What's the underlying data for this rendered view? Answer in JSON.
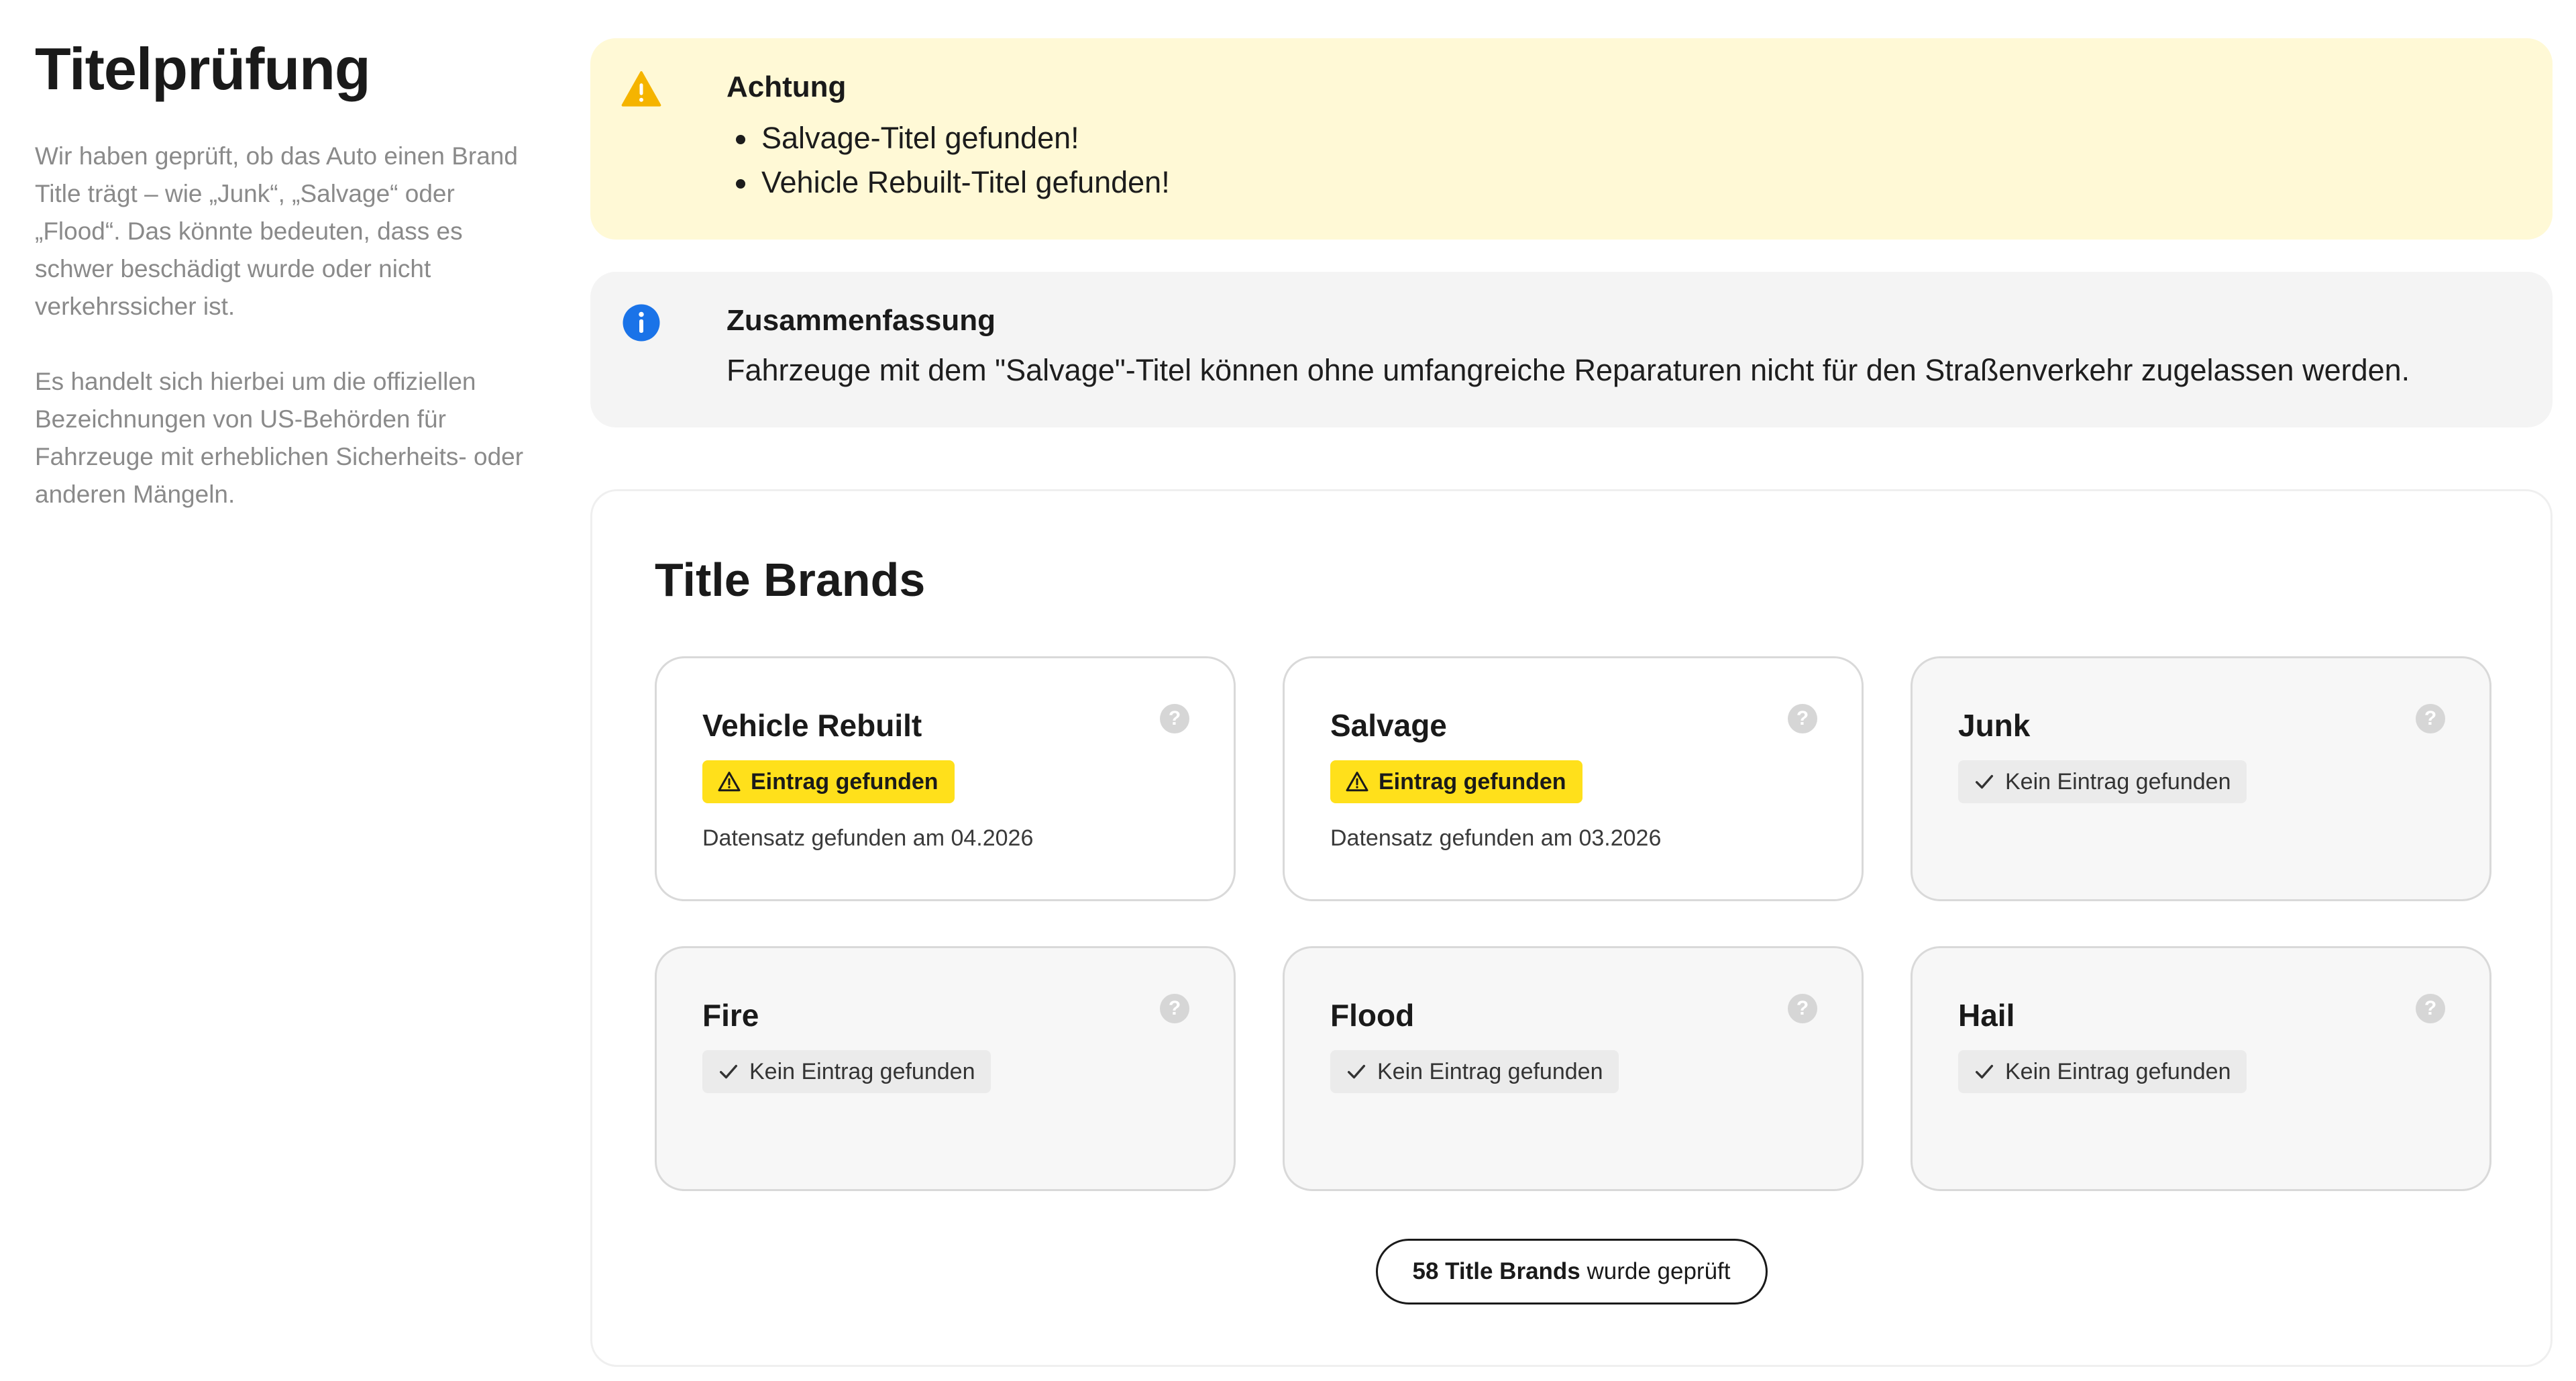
{
  "sidebar": {
    "title": "Titelprüfung",
    "paragraph1": "Wir haben geprüft, ob das Auto einen Brand Title trägt – wie „Junk“, „Salvage“ oder „Flood“. Das könnte bedeuten, dass es schwer beschädigt wurde oder nicht verkehrssicher ist.",
    "paragraph2": "Es handelt sich hierbei um die offiziellen Bezeichnungen von US-Behörden für Fahrzeuge mit erheblichen Sicherheits- oder anderen Mängeln."
  },
  "warning": {
    "title": "Achtung",
    "items": [
      "Salvage-Titel gefunden!",
      "Vehicle Rebuilt-Titel gefunden!"
    ],
    "icon": "warning-triangle-icon",
    "color": "#f5b400"
  },
  "summary": {
    "title": "Zusammenfassung",
    "text": "Fahrzeuge mit dem \"Salvage\"-Titel können ohne umfangreiche Reparaturen nicht für den Straßenverkehr zugelassen werden.",
    "icon": "info-icon",
    "color": "#1a73e8"
  },
  "title_brands": {
    "heading": "Title Brands",
    "cards": [
      {
        "name": "Vehicle Rebuilt",
        "status": "found",
        "badge": "Eintrag gefunden",
        "date": "Datensatz gefunden am 04.2026"
      },
      {
        "name": "Salvage",
        "status": "found",
        "badge": "Eintrag gefunden",
        "date": "Datensatz gefunden am 03.2026"
      },
      {
        "name": "Junk",
        "status": "clean",
        "badge": "Kein Eintrag gefunden",
        "date": ""
      },
      {
        "name": "Fire",
        "status": "clean",
        "badge": "Kein Eintrag gefunden",
        "date": ""
      },
      {
        "name": "Flood",
        "status": "clean",
        "badge": "Kein Eintrag gefunden",
        "date": ""
      },
      {
        "name": "Hail",
        "status": "clean",
        "badge": "Kein Eintrag gefunden",
        "date": ""
      }
    ],
    "checked_count": "58 Title Brands",
    "checked_suffix": " wurde geprüft",
    "help_glyph": "?"
  },
  "colors": {
    "badge_found": "#ffe01b",
    "badge_clean": "#ebebeb",
    "warning_bg": "#fff9d6",
    "summary_bg": "#f4f4f4"
  }
}
